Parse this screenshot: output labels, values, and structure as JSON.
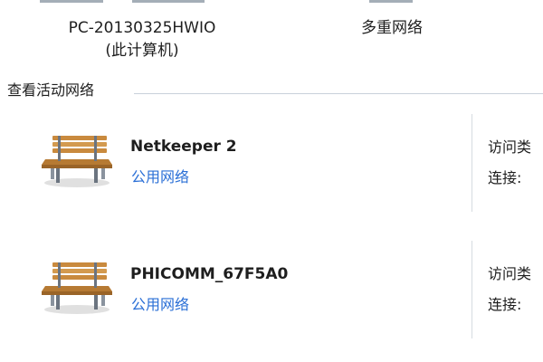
{
  "computer": {
    "name": "PC-20130325HWIO",
    "subtitle": "(此计算机)"
  },
  "network_summary": "多重网络",
  "section": {
    "title": "查看活动网络"
  },
  "networks": [
    {
      "name": "Netkeeper  2",
      "type": "公用网络",
      "icon": "park-bench-icon",
      "access_label": "访问类",
      "connection_label": "连接:"
    },
    {
      "name": "PHICOMM_67F5A0",
      "type": "公用网络",
      "icon": "park-bench-icon",
      "access_label": "访问类",
      "connection_label": "连接:"
    }
  ],
  "colors": {
    "link": "#2a6fd6",
    "bench_wood": "#c98a3e",
    "bench_metal": "#6b7480",
    "rule": "#c9d1da"
  }
}
